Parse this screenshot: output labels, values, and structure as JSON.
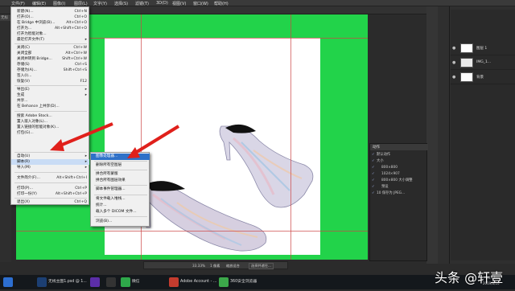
{
  "menubar": [
    "文件(F)",
    "编辑(E)",
    "图像(I)",
    "图层(L)",
    "文字(Y)",
    "选择(S)",
    "滤镜(T)",
    "3D(D)",
    "视图(V)",
    "窗口(W)",
    "帮助(H)"
  ],
  "doc_tab": "无标",
  "file_menu": [
    {
      "label": "新建(N)...",
      "shortcut": "Ctrl+N"
    },
    {
      "label": "打开(O)...",
      "shortcut": "Ctrl+O"
    },
    {
      "label": "在 Bridge 中浏览(B)...",
      "shortcut": "Alt+Ctrl+O"
    },
    {
      "label": "打开为...",
      "shortcut": "Alt+Shift+Ctrl+O"
    },
    {
      "label": "打开为智能对象...",
      "shortcut": ""
    },
    {
      "label": "最近打开文件(T)",
      "shortcut": "",
      "arrow": true
    },
    {
      "sep": true
    },
    {
      "label": "关闭(C)",
      "shortcut": "Ctrl+W"
    },
    {
      "label": "关闭全部",
      "shortcut": "Alt+Ctrl+W"
    },
    {
      "label": "关闭并转到 Bridge...",
      "shortcut": "Shift+Ctrl+W"
    },
    {
      "label": "存储(S)",
      "shortcut": "Ctrl+S"
    },
    {
      "label": "存储为(A)...",
      "shortcut": "Shift+Ctrl+S"
    },
    {
      "label": "签入(I)...",
      "shortcut": ""
    },
    {
      "label": "恢复(V)",
      "shortcut": "F12"
    },
    {
      "sep": true
    },
    {
      "label": "导出(E)",
      "shortcut": "",
      "arrow": true
    },
    {
      "label": "生成",
      "shortcut": "",
      "arrow": true
    },
    {
      "label": "共享...",
      "shortcut": ""
    },
    {
      "label": "在 Behance 上共享(D)...",
      "shortcut": ""
    },
    {
      "sep": true
    },
    {
      "label": "搜索 Adobe Stock...",
      "shortcut": ""
    },
    {
      "label": "置入嵌入对象(L)...",
      "shortcut": ""
    },
    {
      "label": "置入链接的智能对象(K)...",
      "shortcut": ""
    },
    {
      "label": "打包(G)...",
      "shortcut": ""
    },
    {
      "sep": true
    },
    {
      "label": "自动(U)",
      "shortcut": "",
      "arrow": true
    },
    {
      "label": "脚本(R)",
      "shortcut": "",
      "arrow": true,
      "hl": true
    },
    {
      "label": "导入(M)",
      "shortcut": "",
      "arrow": true
    },
    {
      "sep": true
    },
    {
      "label": "文件简介(F)...",
      "shortcut": "Alt+Shift+Ctrl+I"
    },
    {
      "sep": true
    },
    {
      "label": "打印(P)...",
      "shortcut": "Ctrl+P"
    },
    {
      "label": "打印一份(Y)",
      "shortcut": "Alt+Shift+Ctrl+P"
    },
    {
      "sep": true
    },
    {
      "label": "退出(X)",
      "shortcut": "Ctrl+Q"
    }
  ],
  "script_menu": [
    {
      "label": "图像处理器...",
      "hl": true
    },
    {
      "sep": true
    },
    {
      "label": "删除所有空图层"
    },
    {
      "sep": true
    },
    {
      "label": "拼合所有蒙版"
    },
    {
      "label": "拼合所有图层效果"
    },
    {
      "sep": true
    },
    {
      "label": "脚本事件管理器..."
    },
    {
      "sep": true
    },
    {
      "label": "将文件载入堆栈..."
    },
    {
      "label": "统计..."
    },
    {
      "label": "载入多个 DICOM 文件..."
    },
    {
      "sep": true
    },
    {
      "label": "浏览(B)..."
    }
  ],
  "layers": [
    {
      "name": "图层 1"
    },
    {
      "name": "IMG_1..."
    },
    {
      "name": "背景"
    }
  ],
  "actions_panel": {
    "title": "动作",
    "rows": [
      "默认动作",
      "大小",
      "800×800",
      "1024×907",
      "800×800 大小调整",
      "预设",
      "10 保存为 JPEG..."
    ]
  },
  "docbar": {
    "zoom": "33.33%",
    "info": "1 像素",
    "btn1": "缩放适合",
    "btn2": "选择并遮住..."
  },
  "taskbar": [
    {
      "label": "无线主图1.psd @ 1..."
    },
    {
      "label": ""
    },
    {
      "label": ""
    },
    {
      "label": "微信"
    },
    {
      "label": "Adobe Account - ..."
    },
    {
      "label": "360安全浏览器"
    }
  ],
  "clock": {
    "time": "16:17",
    "date": "2019/8/10"
  },
  "watermark": "头条 @轩壹",
  "colors": {
    "canvas_bg": "#22d34a",
    "menu_highlight": "#2f71c8",
    "arrow": "#e0201b"
  }
}
